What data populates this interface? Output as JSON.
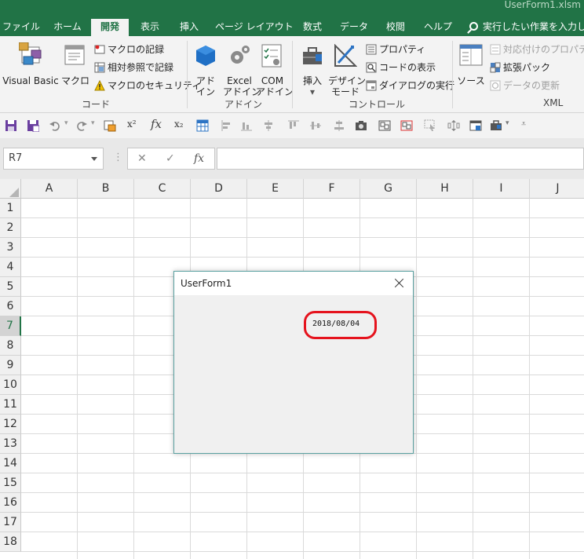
{
  "window": {
    "file_title": "UserForm1.xlsm"
  },
  "tabs": [
    {
      "label": "ファイル"
    },
    {
      "label": "ホーム"
    },
    {
      "label": "開発",
      "active": true
    },
    {
      "label": "表示"
    },
    {
      "label": "挿入"
    },
    {
      "label": "ページ レイアウト"
    },
    {
      "label": "数式"
    },
    {
      "label": "データ"
    },
    {
      "label": "校閲"
    },
    {
      "label": "ヘルプ"
    }
  ],
  "tellme": {
    "placeholder": "実行したい作業を入力して"
  },
  "ribbon": {
    "code": {
      "label": "コード",
      "visual_basic": "Visual Basic",
      "macro": "マクロ",
      "record_macro": "マクロの記録",
      "relative_ref": "相対参照で記録",
      "macro_security": "マクロのセキュリティ"
    },
    "addins": {
      "label": "アドイン",
      "addin_l1": "アド",
      "addin_l2": "イン",
      "excel_l1": "Excel",
      "excel_l2": "アドイン",
      "com_l1": "COM",
      "com_l2": "アドイン"
    },
    "controls": {
      "label": "コントロール",
      "insert": "挿入",
      "design_l1": "デザイン",
      "design_l2": "モード",
      "properties": "プロパティ",
      "view_code": "コードの表示",
      "run_dialog": "ダイアログの実行"
    },
    "xml": {
      "label": "XML",
      "source": "ソース",
      "map_props": "対応付けのプロパティ",
      "expansion": "拡張パック",
      "refresh": "データの更新"
    }
  },
  "formula_bar": {
    "name_box": "R7",
    "fx": "fx",
    "cancel": "✕",
    "enter": "✓",
    "more": "⋮"
  },
  "grid": {
    "columns": [
      "A",
      "B",
      "C",
      "D",
      "E",
      "F",
      "G",
      "H",
      "I",
      "J"
    ],
    "rows": [
      "1",
      "2",
      "3",
      "4",
      "5",
      "6",
      "7",
      "8",
      "9",
      "10",
      "11",
      "12",
      "13",
      "14",
      "15",
      "16",
      "17",
      "18"
    ],
    "selected_row": "7",
    "accent": "#217346"
  },
  "userform": {
    "title": "UserForm1",
    "date_text": "2018/08/04",
    "highlight_color": "#e5131d"
  }
}
